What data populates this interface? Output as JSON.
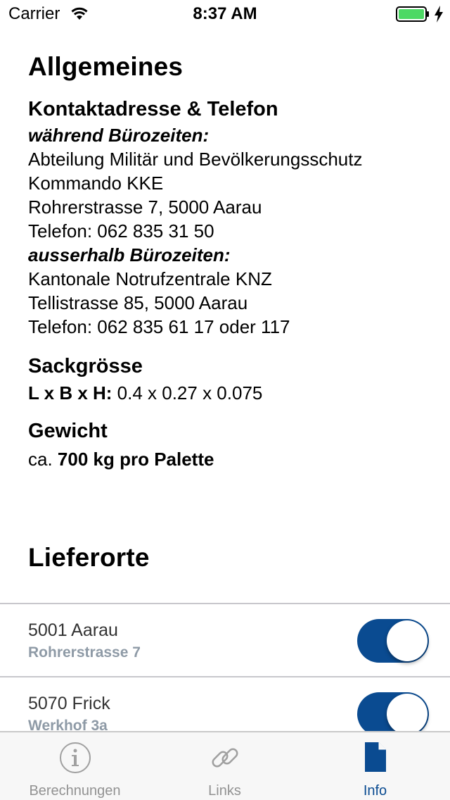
{
  "status_bar": {
    "carrier": "Carrier",
    "time": "8:37 AM",
    "battery_color": "#4cd964"
  },
  "general": {
    "heading": "Allgemeines",
    "contact": {
      "title": "Kontaktadresse & Telefon",
      "office_hours_label": "während Bürozeiten:",
      "office_lines": [
        "Abteilung Militär und Bevölkerungsschutz",
        "Kommando KKE",
        "Rohrerstrasse 7, 5000 Aarau",
        "Telefon: 062 835 31 50"
      ],
      "after_hours_label": "ausserhalb Bürozeiten:",
      "after_lines": [
        "Kantonale Notrufzentrale KNZ",
        "Tellistrasse 85, 5000 Aarau",
        "Telefon: 062 835 61 17 oder 117"
      ]
    },
    "bag_size": {
      "title": "Sackgrösse",
      "label": "L x B x H:",
      "value": " 0.4 x 0.27 x 0.075"
    },
    "weight": {
      "title": "Gewicht",
      "prefix": "ca. ",
      "value": "700 kg pro Palette"
    }
  },
  "delivery": {
    "heading": "Lieferorte",
    "items": [
      {
        "title": "5001 Aarau",
        "subtitle": "Rohrerstrasse 7",
        "enabled": true
      },
      {
        "title": "5070 Frick",
        "subtitle": "Werkhof 3a",
        "enabled": true
      }
    ]
  },
  "tabs": [
    {
      "label": "Berechnungen",
      "icon": "info-circle-icon",
      "active": false
    },
    {
      "label": "Links",
      "icon": "link-icon",
      "active": false
    },
    {
      "label": "Info",
      "icon": "document-icon",
      "active": true
    }
  ],
  "colors": {
    "accent": "#0a4b91",
    "inactive": "#929292",
    "subtitle": "#8e9aa6"
  }
}
